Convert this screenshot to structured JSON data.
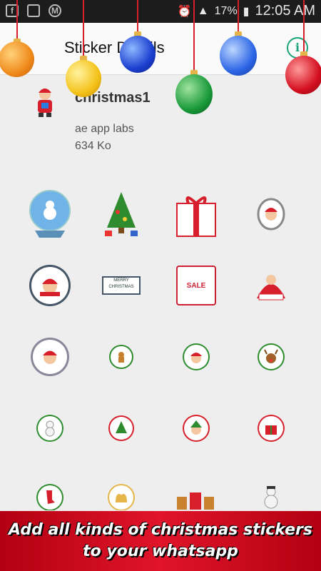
{
  "status_bar": {
    "battery": "17%",
    "time": "12:05 AM"
  },
  "app_bar": {
    "title": "Sticker Details"
  },
  "pack": {
    "name": "christmas1",
    "author": "ae app labs",
    "size": "634 Ko"
  },
  "stickers": [
    {
      "name": "snow-globe-sticker"
    },
    {
      "name": "christmas-tree-sticker"
    },
    {
      "name": "gift-box-sticker"
    },
    {
      "name": "santa-badge-sticker"
    },
    {
      "name": "santa-merry-xmas-sticker"
    },
    {
      "name": "merry-christmas-banner-sticker"
    },
    {
      "name": "christmas-sale-sticker"
    },
    {
      "name": "santa-arms-up-sticker"
    },
    {
      "name": "santa-round-badge-sticker"
    },
    {
      "name": "gingerbread-sticker"
    },
    {
      "name": "santa-head-sticker"
    },
    {
      "name": "reindeer-sticker"
    },
    {
      "name": "snowman-sticker"
    },
    {
      "name": "tree-badge-sticker"
    },
    {
      "name": "elf-sticker"
    },
    {
      "name": "present-badge-sticker"
    },
    {
      "name": "stocking-sticker"
    },
    {
      "name": "bells-sticker"
    },
    {
      "name": "village-sticker"
    },
    {
      "name": "snowman-tree-sticker"
    }
  ],
  "banner": {
    "line1": "Add all kinds of christmas stickers",
    "line2": "to your whatsapp"
  },
  "colors": {
    "accent": "#1aa37a",
    "banner": "#d0142a"
  }
}
